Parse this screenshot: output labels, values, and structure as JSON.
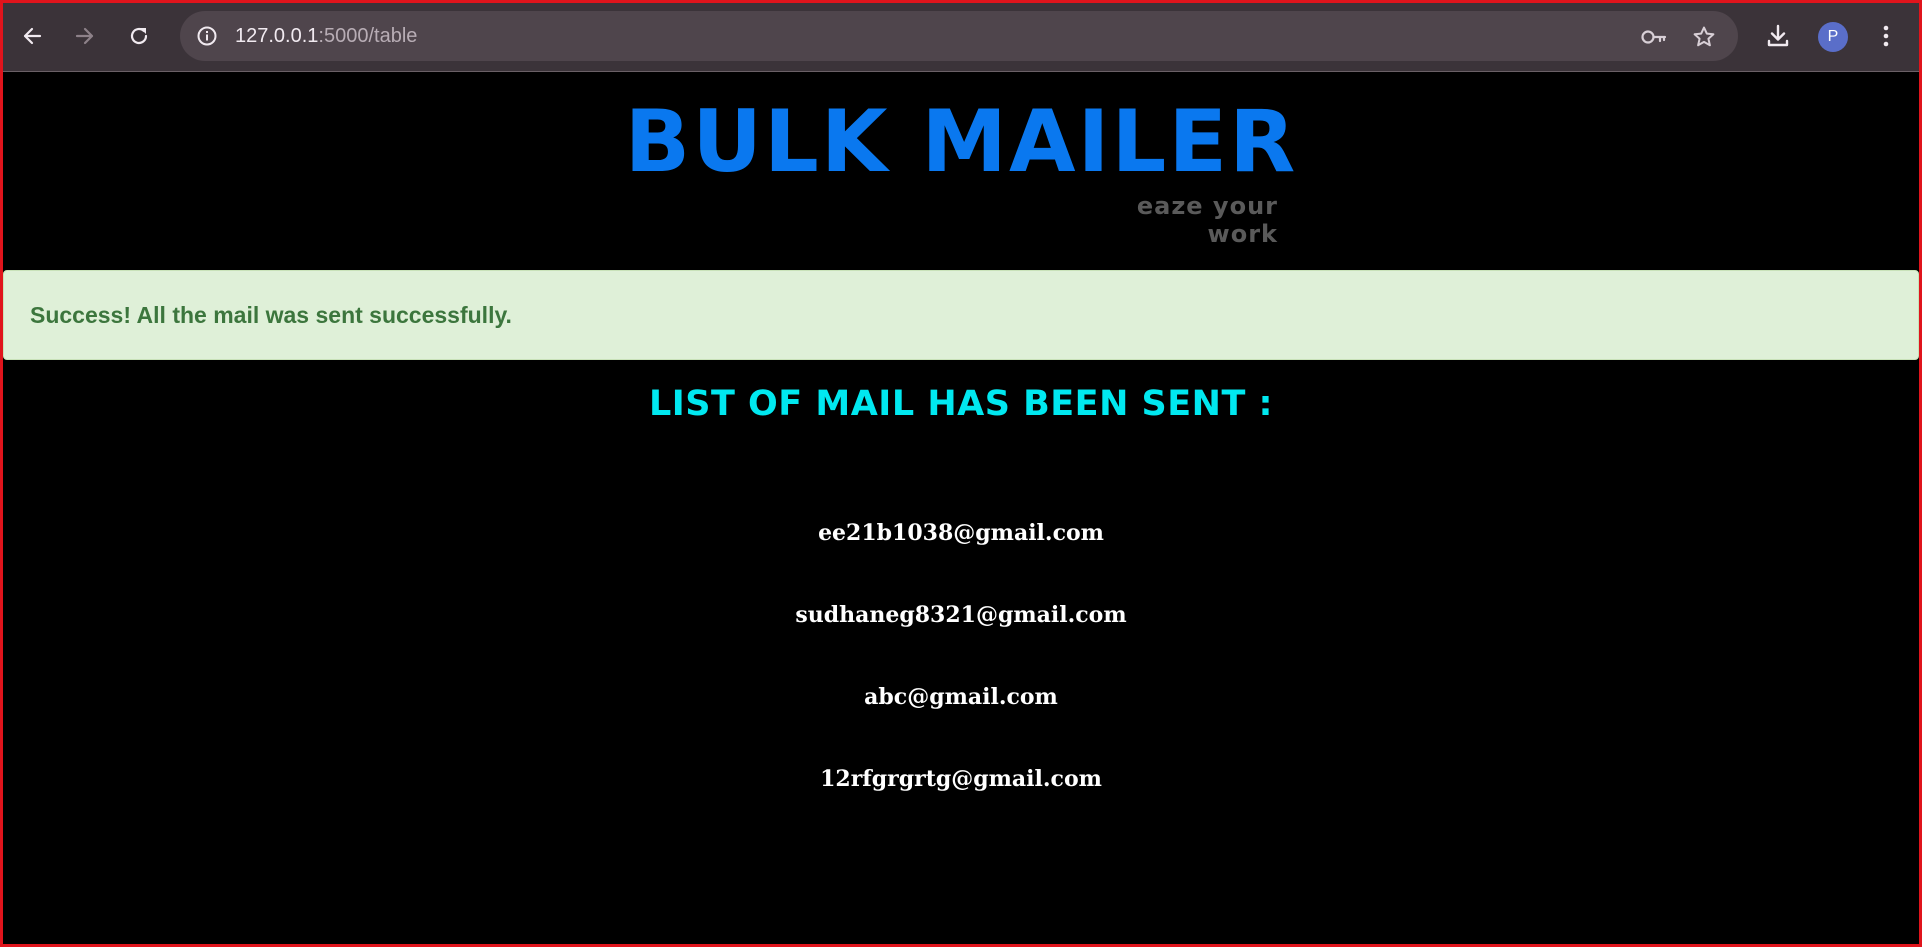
{
  "browser": {
    "url_host": "127.0.0.1",
    "url_path": ":5000/table",
    "avatar_initial": "P",
    "icons": {
      "back": "arrow-left-icon",
      "forward": "arrow-right-icon",
      "reload": "reload-icon",
      "site_info": "info-icon",
      "password": "key-icon",
      "bookmark": "star-icon",
      "download": "download-icon",
      "menu": "kebab-menu-icon"
    }
  },
  "header": {
    "title": "BULK MAILER",
    "tagline": "eaze your work"
  },
  "alert": {
    "message": "Success! All the mail was sent successfully."
  },
  "list": {
    "heading": "LIST OF MAIL HAS BEEN SENT :",
    "emails": [
      "ee21b1038@gmail.com",
      "sudhaneg8321@gmail.com",
      "abc@gmail.com",
      "12rfgrgrtg@gmail.com"
    ]
  },
  "colors": {
    "title": "#0a78ef",
    "tagline": "#5a5a5a",
    "alert_bg": "#dff0d8",
    "alert_text": "#3c763d",
    "heading": "#00e8f0",
    "email_text": "#ffffff",
    "page_bg": "#000000",
    "window_border": "#e0141c"
  }
}
